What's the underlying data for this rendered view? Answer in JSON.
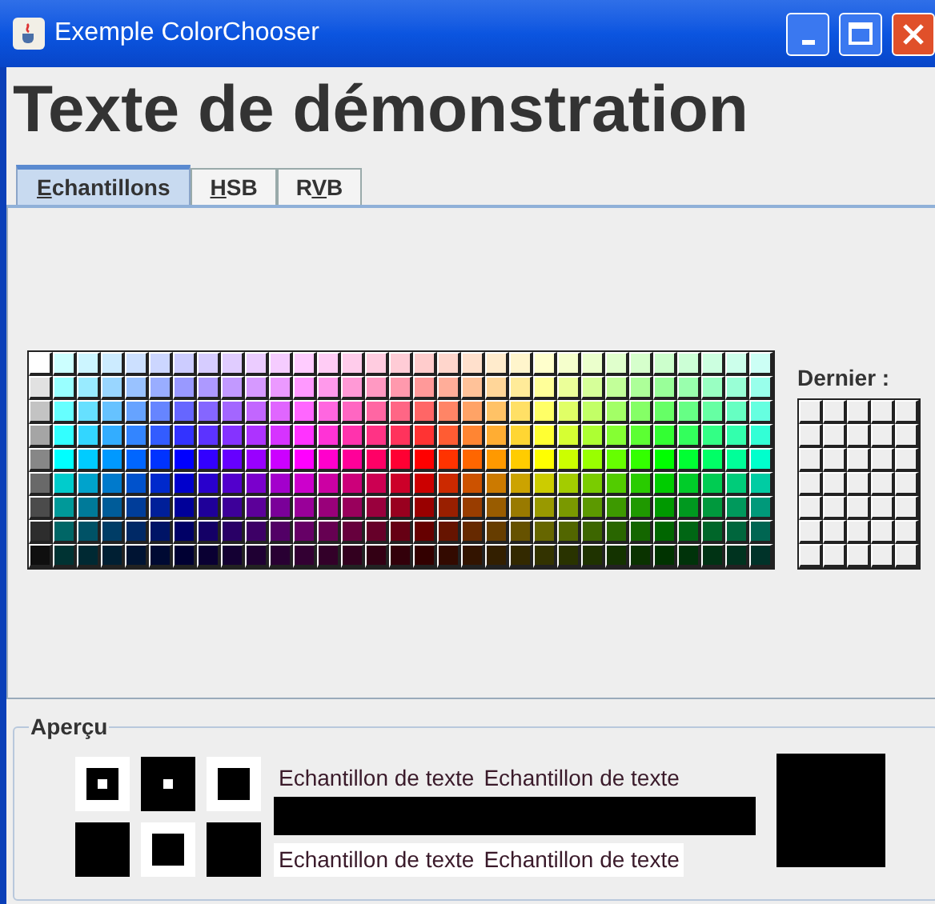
{
  "window": {
    "title": "Exemple ColorChooser"
  },
  "heading": "Texte de démonstration",
  "tabs": [
    {
      "key": "E",
      "post": "chantillons",
      "selected": true
    },
    {
      "key": "H",
      "post": "SB",
      "selected": false
    },
    {
      "pre": "R",
      "key": "V",
      "post": "B",
      "selected": false
    }
  ],
  "recent": {
    "label": "Dernier :"
  },
  "preview": {
    "title": "Aperçu",
    "sample_texts": [
      "Echantillon de texte",
      "Echantillon de texte",
      "Echantillon de texte",
      "Echantillon de texte"
    ]
  }
}
